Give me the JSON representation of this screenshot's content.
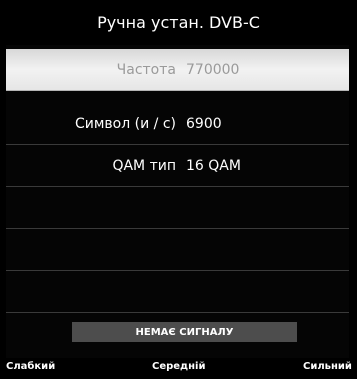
{
  "header": {
    "title": "Ручна устан. DVB-C"
  },
  "settings": [
    {
      "label": "Частота",
      "value": "770000",
      "selected": true
    },
    {
      "label": "Символ (и / с)",
      "value": "6900",
      "selected": false
    },
    {
      "label": "QAM тип",
      "value": "16 QAM",
      "selected": false
    }
  ],
  "signal": {
    "status": "НЕМАЄ СИГНАЛУ",
    "scale": {
      "weak": "Слабкий",
      "medium": "Середній",
      "strong": "Сильний"
    }
  },
  "colors": {
    "background": "#000000",
    "selected_row": "#eeeeee",
    "signal_bar": "#4d4d4d"
  }
}
